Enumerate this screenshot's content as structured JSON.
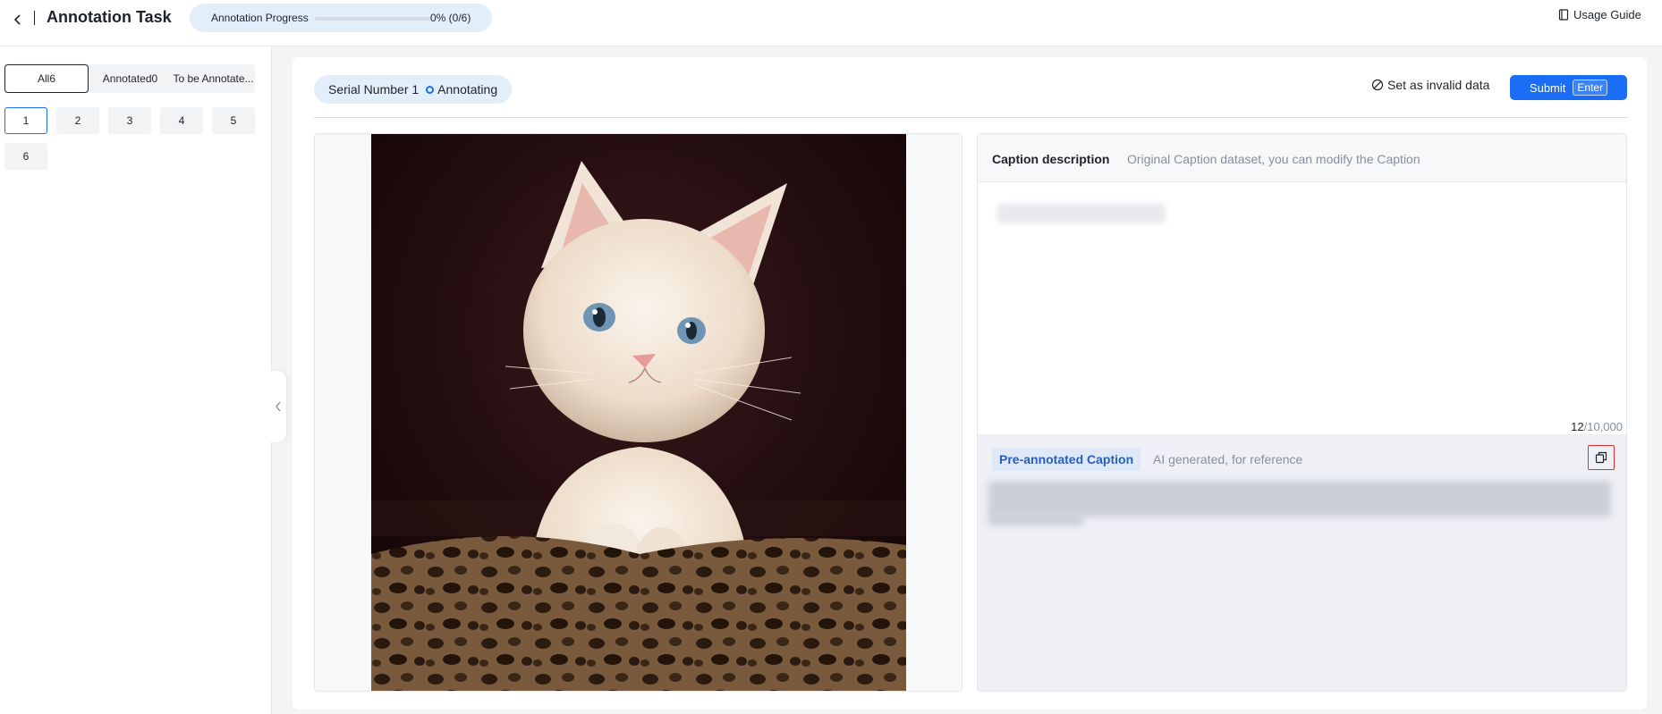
{
  "header": {
    "title": "Annotation Task",
    "back_icon": "chevron-left-icon",
    "progress_label": "Annotation Progress",
    "progress_value": "0% (0/6)",
    "progress_fraction": 0,
    "usage_guide_label": "Usage Guide",
    "usage_guide_icon": "book-icon"
  },
  "sidebar": {
    "tabs": [
      {
        "label": "All6"
      },
      {
        "label": "Annotated0"
      },
      {
        "label": "To be Annotate..."
      }
    ],
    "items": [
      {
        "label": "1"
      },
      {
        "label": "2"
      },
      {
        "label": "3"
      },
      {
        "label": "4"
      },
      {
        "label": "5"
      },
      {
        "label": "6"
      }
    ],
    "active_index": 0
  },
  "main": {
    "serial_label": "Serial Number 1",
    "status_label": "Annotating",
    "invalid_label": "Set as invalid data",
    "submit_label": "Submit",
    "submit_key": "Enter",
    "image_alt": "kitten photo"
  },
  "caption": {
    "title": "Caption description",
    "subtitle": "Original Caption dataset, you can modify the Caption",
    "char_current": "12",
    "char_max": "/10,000",
    "pre_tag": "Pre-annotated Caption",
    "pre_sub": "AI generated, for reference",
    "copy_icon": "copy-icon"
  },
  "colors": {
    "accent": "#1a6ef5",
    "pill_bg": "#e3eefb",
    "highlight_border": "#e0302b"
  }
}
